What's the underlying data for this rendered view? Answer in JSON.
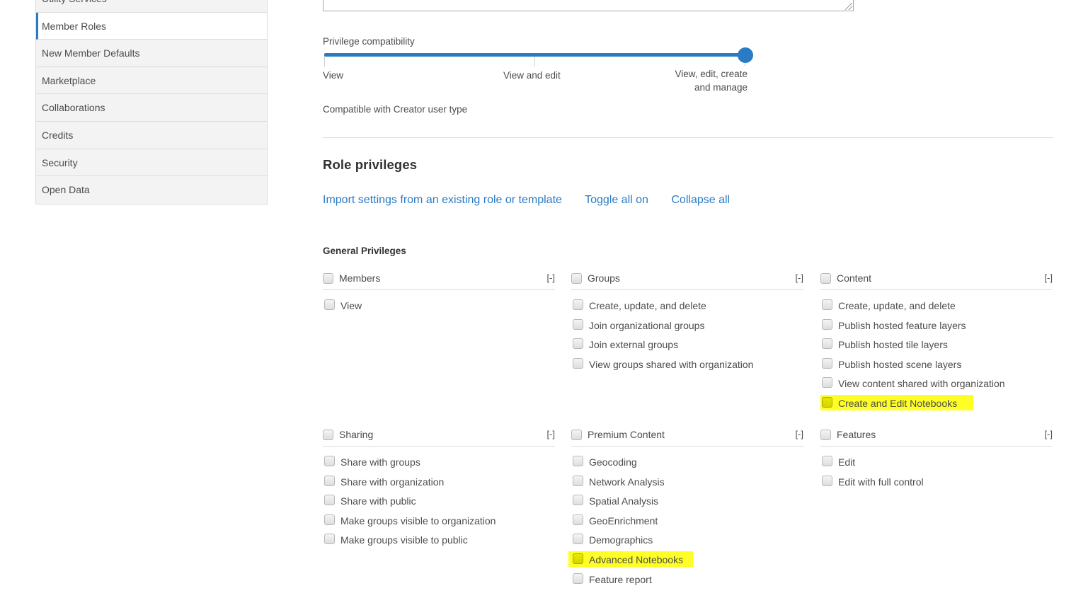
{
  "sidebar": {
    "items": [
      {
        "label": "Utility Services",
        "active": false
      },
      {
        "label": "Member Roles",
        "active": true
      },
      {
        "label": "New Member Defaults",
        "active": false
      },
      {
        "label": "Marketplace",
        "active": false
      },
      {
        "label": "Collaborations",
        "active": false
      },
      {
        "label": "Credits",
        "active": false
      },
      {
        "label": "Security",
        "active": false
      },
      {
        "label": "Open Data",
        "active": false
      }
    ]
  },
  "privilege_compatibility": {
    "label": "Privilege compatibility",
    "levels": [
      "View",
      "View and edit",
      "View, edit, create",
      "and manage"
    ],
    "selected_level": "View, edit, create and manage",
    "selected_index": 2,
    "compatible_text": "Compatible with Creator user type"
  },
  "role_privileges": {
    "title": "Role privileges",
    "links": {
      "import": "Import settings from an existing role or template",
      "toggle": "Toggle all on",
      "collapse": "Collapse all"
    },
    "section_title": "General Privileges",
    "collapse_label": "[-]",
    "groups": [
      {
        "name": "Members",
        "items": [
          "View"
        ]
      },
      {
        "name": "Groups",
        "items": [
          "Create, update, and delete",
          "Join organizational groups",
          "Join external groups",
          "View groups shared with organization"
        ]
      },
      {
        "name": "Content",
        "items": [
          "Create, update, and delete",
          "Publish hosted feature layers",
          "Publish hosted tile layers",
          "Publish hosted scene layers",
          "View content shared with organization",
          "Create and Edit Notebooks"
        ]
      },
      {
        "name": "Sharing",
        "items": [
          "Share with groups",
          "Share with organization",
          "Share with public",
          "Make groups visible to organization",
          "Make groups visible to public"
        ]
      },
      {
        "name": "Premium Content",
        "items": [
          "Geocoding",
          "Network Analysis",
          "Spatial Analysis",
          "GeoEnrichment",
          "Demographics",
          "Advanced Notebooks",
          "Feature report"
        ]
      },
      {
        "name": "Features",
        "items": [
          "Edit",
          "Edit with full control"
        ]
      }
    ],
    "highlighted": [
      "Create and Edit Notebooks",
      "Advanced Notebooks"
    ],
    "highlight_color": "#ffff00"
  },
  "colors": {
    "accent": "#2b7bc4"
  }
}
